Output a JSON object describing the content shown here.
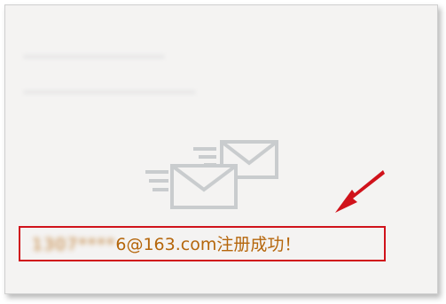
{
  "panel": {
    "icon": "mail-sent-icon"
  },
  "registration": {
    "email_hidden": "1307****",
    "email_visible": "6@163.com",
    "success_text": "注册成功！"
  },
  "annotation": {
    "box_color": "#d0121b",
    "arrow_color": "#d0121b",
    "message_color": "#b5660b"
  }
}
